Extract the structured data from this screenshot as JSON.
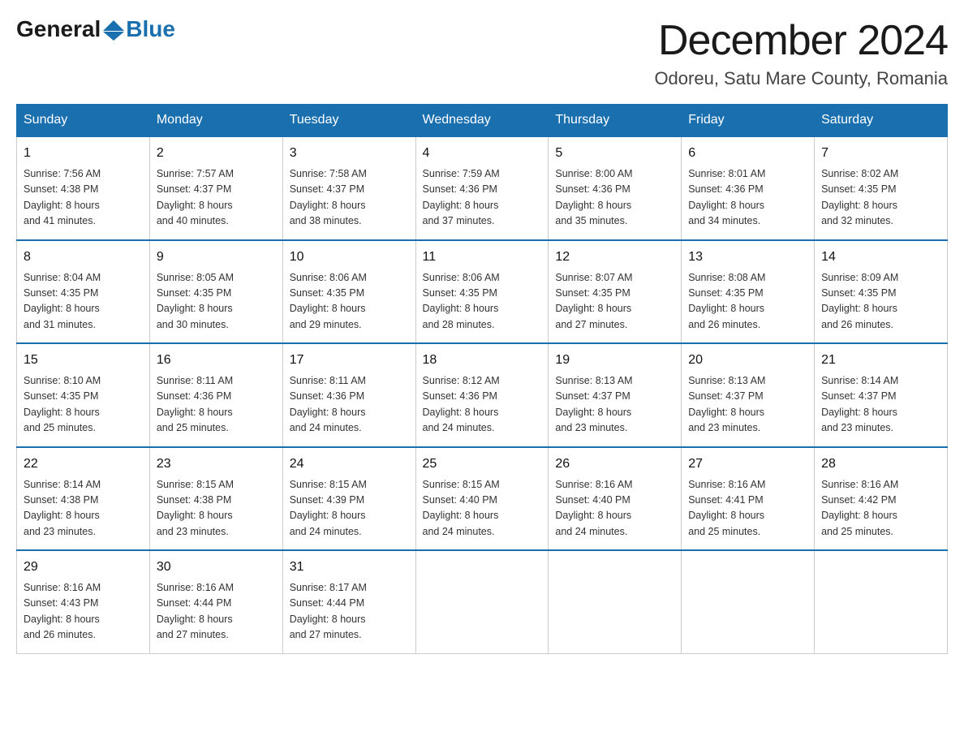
{
  "header": {
    "logo_general": "General",
    "logo_blue": "Blue",
    "month_title": "December 2024",
    "subtitle": "Odoreu, Satu Mare County, Romania"
  },
  "days_of_week": [
    "Sunday",
    "Monday",
    "Tuesday",
    "Wednesday",
    "Thursday",
    "Friday",
    "Saturday"
  ],
  "weeks": [
    [
      {
        "day": "1",
        "sunrise": "7:56 AM",
        "sunset": "4:38 PM",
        "daylight": "8 hours and 41 minutes."
      },
      {
        "day": "2",
        "sunrise": "7:57 AM",
        "sunset": "4:37 PM",
        "daylight": "8 hours and 40 minutes."
      },
      {
        "day": "3",
        "sunrise": "7:58 AM",
        "sunset": "4:37 PM",
        "daylight": "8 hours and 38 minutes."
      },
      {
        "day": "4",
        "sunrise": "7:59 AM",
        "sunset": "4:36 PM",
        "daylight": "8 hours and 37 minutes."
      },
      {
        "day": "5",
        "sunrise": "8:00 AM",
        "sunset": "4:36 PM",
        "daylight": "8 hours and 35 minutes."
      },
      {
        "day": "6",
        "sunrise": "8:01 AM",
        "sunset": "4:36 PM",
        "daylight": "8 hours and 34 minutes."
      },
      {
        "day": "7",
        "sunrise": "8:02 AM",
        "sunset": "4:35 PM",
        "daylight": "8 hours and 32 minutes."
      }
    ],
    [
      {
        "day": "8",
        "sunrise": "8:04 AM",
        "sunset": "4:35 PM",
        "daylight": "8 hours and 31 minutes."
      },
      {
        "day": "9",
        "sunrise": "8:05 AM",
        "sunset": "4:35 PM",
        "daylight": "8 hours and 30 minutes."
      },
      {
        "day": "10",
        "sunrise": "8:06 AM",
        "sunset": "4:35 PM",
        "daylight": "8 hours and 29 minutes."
      },
      {
        "day": "11",
        "sunrise": "8:06 AM",
        "sunset": "4:35 PM",
        "daylight": "8 hours and 28 minutes."
      },
      {
        "day": "12",
        "sunrise": "8:07 AM",
        "sunset": "4:35 PM",
        "daylight": "8 hours and 27 minutes."
      },
      {
        "day": "13",
        "sunrise": "8:08 AM",
        "sunset": "4:35 PM",
        "daylight": "8 hours and 26 minutes."
      },
      {
        "day": "14",
        "sunrise": "8:09 AM",
        "sunset": "4:35 PM",
        "daylight": "8 hours and 26 minutes."
      }
    ],
    [
      {
        "day": "15",
        "sunrise": "8:10 AM",
        "sunset": "4:35 PM",
        "daylight": "8 hours and 25 minutes."
      },
      {
        "day": "16",
        "sunrise": "8:11 AM",
        "sunset": "4:36 PM",
        "daylight": "8 hours and 25 minutes."
      },
      {
        "day": "17",
        "sunrise": "8:11 AM",
        "sunset": "4:36 PM",
        "daylight": "8 hours and 24 minutes."
      },
      {
        "day": "18",
        "sunrise": "8:12 AM",
        "sunset": "4:36 PM",
        "daylight": "8 hours and 24 minutes."
      },
      {
        "day": "19",
        "sunrise": "8:13 AM",
        "sunset": "4:37 PM",
        "daylight": "8 hours and 23 minutes."
      },
      {
        "day": "20",
        "sunrise": "8:13 AM",
        "sunset": "4:37 PM",
        "daylight": "8 hours and 23 minutes."
      },
      {
        "day": "21",
        "sunrise": "8:14 AM",
        "sunset": "4:37 PM",
        "daylight": "8 hours and 23 minutes."
      }
    ],
    [
      {
        "day": "22",
        "sunrise": "8:14 AM",
        "sunset": "4:38 PM",
        "daylight": "8 hours and 23 minutes."
      },
      {
        "day": "23",
        "sunrise": "8:15 AM",
        "sunset": "4:38 PM",
        "daylight": "8 hours and 23 minutes."
      },
      {
        "day": "24",
        "sunrise": "8:15 AM",
        "sunset": "4:39 PM",
        "daylight": "8 hours and 24 minutes."
      },
      {
        "day": "25",
        "sunrise": "8:15 AM",
        "sunset": "4:40 PM",
        "daylight": "8 hours and 24 minutes."
      },
      {
        "day": "26",
        "sunrise": "8:16 AM",
        "sunset": "4:40 PM",
        "daylight": "8 hours and 24 minutes."
      },
      {
        "day": "27",
        "sunrise": "8:16 AM",
        "sunset": "4:41 PM",
        "daylight": "8 hours and 25 minutes."
      },
      {
        "day": "28",
        "sunrise": "8:16 AM",
        "sunset": "4:42 PM",
        "daylight": "8 hours and 25 minutes."
      }
    ],
    [
      {
        "day": "29",
        "sunrise": "8:16 AM",
        "sunset": "4:43 PM",
        "daylight": "8 hours and 26 minutes."
      },
      {
        "day": "30",
        "sunrise": "8:16 AM",
        "sunset": "4:44 PM",
        "daylight": "8 hours and 27 minutes."
      },
      {
        "day": "31",
        "sunrise": "8:17 AM",
        "sunset": "4:44 PM",
        "daylight": "8 hours and 27 minutes."
      },
      null,
      null,
      null,
      null
    ]
  ],
  "labels": {
    "sunrise": "Sunrise:",
    "sunset": "Sunset:",
    "daylight": "Daylight:"
  }
}
